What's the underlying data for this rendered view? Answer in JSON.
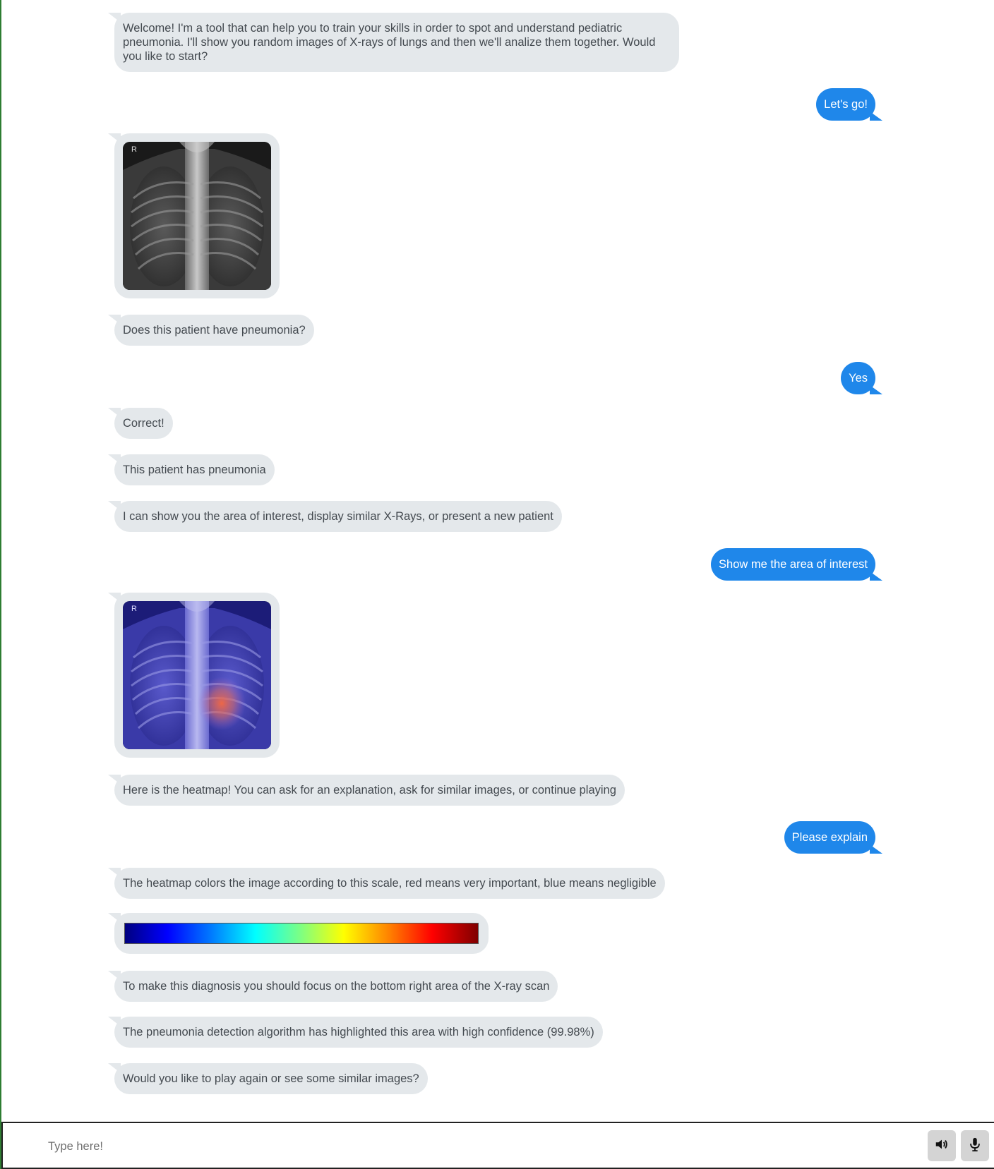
{
  "messages": {
    "m1": "Welcome! I'm a tool that can help you to train your skills in order to spot and understand pediatric pneumonia. I'll show you random images of X-rays of lungs and then we'll analize them together. Would you like to start?",
    "m2": "Let's go!",
    "m3": "Does this patient have pneumonia?",
    "m4": "Yes",
    "m5": "Correct!",
    "m6": "This patient has pneumonia",
    "m7": "I can show you the area of interest, display similar X-Rays, or present a new patient",
    "m8": "Show me the area of interest",
    "m9": "Here is the heatmap! You can ask for an explanation, ask for similar images, or continue playing",
    "m10": "Please explain",
    "m11": "The heatmap colors the image according to this scale, red means very important, blue means negligible",
    "m12": "To make this diagnosis you should focus on the bottom right area of the X-ray scan",
    "m13": "The pneumonia detection algorithm has highlighted this area with high confidence (99.98%)",
    "m14": "Would you like to play again or see some similar images?"
  },
  "xray_marker": "R",
  "input": {
    "placeholder": "Type here!"
  },
  "icons": {
    "speaker": "speaker-icon",
    "mic": "microphone-icon"
  },
  "colors": {
    "bot_bubble": "#e4e8eb",
    "user_bubble": "#1f87ea"
  }
}
